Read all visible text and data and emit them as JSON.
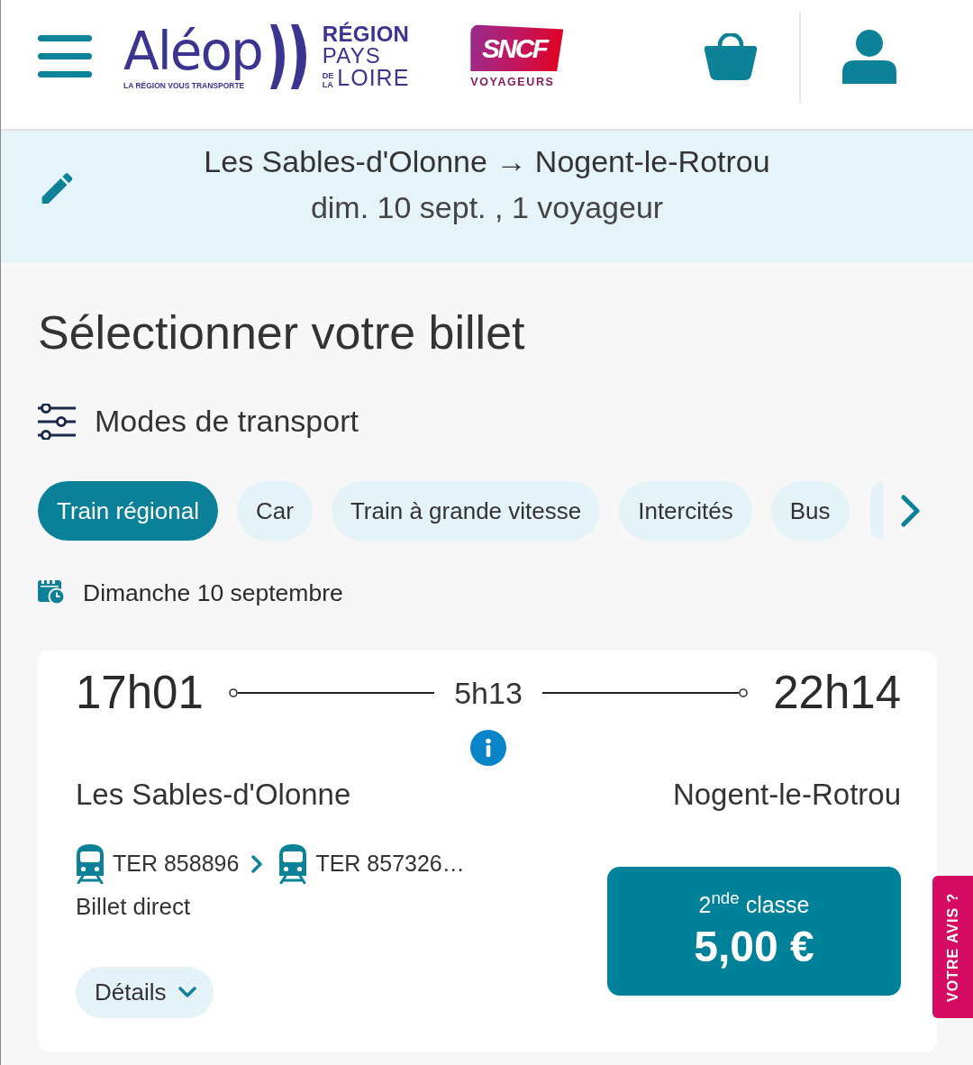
{
  "header": {
    "logo": {
      "wordmark": "Aléop",
      "tagline": "LA RÉGION VOUS TRANSPORTE"
    },
    "region_logo": {
      "lines": [
        "RÉGION",
        "PAYS"
      ],
      "small": [
        "DE",
        "LA"
      ],
      "last": "LOIRE"
    },
    "operator_logo": {
      "badge": "SNCF",
      "caption": "VOYAGEURS"
    }
  },
  "search_summary": {
    "route": "Les Sables-d'Olonne → Nogent-le-Rotrou",
    "details": "dim. 10 sept. , 1 voyageur"
  },
  "title": "Sélectionner votre billet",
  "filter": {
    "label": "Modes de transport"
  },
  "modes": {
    "chips": [
      {
        "label": "Train régional",
        "selected": true
      },
      {
        "label": "Car",
        "selected": false
      },
      {
        "label": "Train à grande vitesse",
        "selected": false
      },
      {
        "label": "Intercités",
        "selected": false
      },
      {
        "label": "Bus",
        "selected": false
      }
    ],
    "more_chips_hidden": true
  },
  "date_heading": "Dimanche 10 septembre",
  "journeys": [
    {
      "departure_time": "17h01",
      "duration": "5h13",
      "arrival_time": "22h14",
      "origin": "Les Sables-d'Olonne",
      "destination": "Nogent-le-Rotrou",
      "segments": [
        {
          "label": "TER 858896"
        },
        {
          "label": "TER 857326…"
        }
      ],
      "ticket_type": "Billet direct",
      "details_button": "Détails",
      "fare": {
        "class": "2$^{nde}$ classe",
        "price": "5,00 €"
      }
    }
  ],
  "feedback_tab": "VOTRE AVIS ?"
}
